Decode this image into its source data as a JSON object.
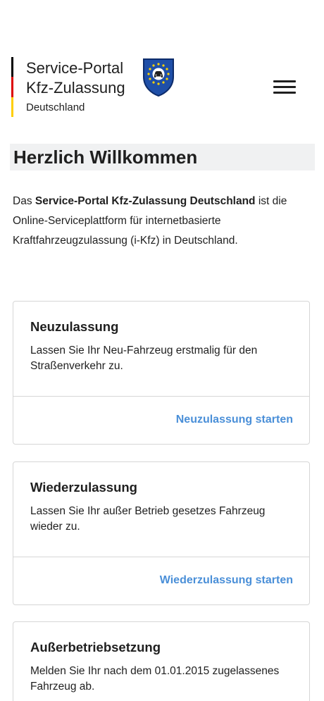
{
  "header": {
    "brand_line1": "Service-Portal",
    "brand_line2": "Kfz-Zulassung",
    "brand_sub": "Deutschland",
    "logo_icon": "eu-car-shield-icon",
    "menu_icon": "hamburger-menu-icon",
    "flag_colors": [
      "#000000",
      "#dd0000",
      "#ffce00"
    ]
  },
  "welcome": {
    "title": "Herzlich Willkommen",
    "intro_prefix": "Das ",
    "intro_bold": "Service-Portal Kfz-Zulassung Deutschland",
    "intro_suffix": " ist die Online-Serviceplattform für internetbasierte Kraftfahrzeugzulassung (i-Kfz) in Deutschland."
  },
  "cards": [
    {
      "title": "Neuzulassung",
      "text": "Lassen Sie Ihr Neu-Fahrzeug erstmalig für den Straßenverkehr zu.",
      "link": "Neuzulassung starten"
    },
    {
      "title": "Wiederzulassung",
      "text": "Lassen Sie Ihr außer Betrieb gesetzes Fahrzeug wieder zu.",
      "link": "Wiederzulassung starten"
    },
    {
      "title": "Außerbetriebsetzung",
      "text": "Melden Sie Ihr nach dem 01.01.2015 zugelassenes Fahrzeug ab."
    }
  ],
  "colors": {
    "link": "#4a8fd8",
    "title_background": "#f0f1f2",
    "border": "#d6d6d6",
    "eu_blue": "#1f4fa8",
    "eu_star": "#ffd200"
  }
}
